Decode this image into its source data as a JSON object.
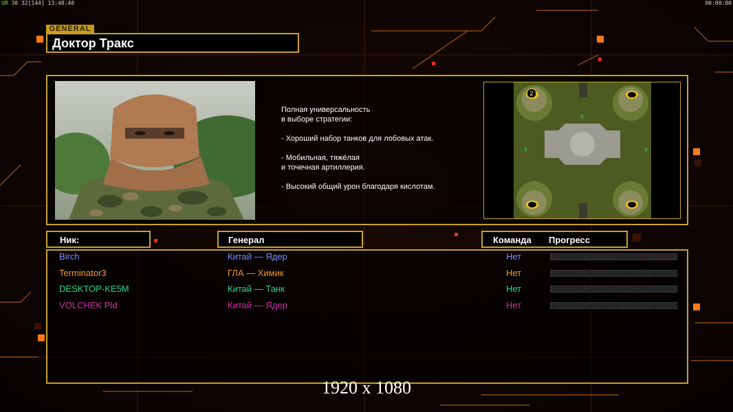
{
  "hud": {
    "stats_prefix": "UR",
    "fps": "30",
    "stat2": "32",
    "stat3": "[144]",
    "clock": "13:48:40",
    "timer": "00:00:00"
  },
  "general": {
    "tag": "GENERAL",
    "name": "Доктор Тракс"
  },
  "description": [
    "Полная универсальность",
    "в выборе стратегии:",
    "",
    "- Хороший набор танков для лобовых атак.",
    "",
    "- Мобильная, тяжёлая",
    "и точечная артиллерия.",
    "",
    "- Высокий общий урон благодаря кислотам."
  ],
  "map": {
    "start_marker": "2",
    "icon": "map-preview"
  },
  "headers": {
    "nick": "Ник:",
    "general": "Генерал",
    "team": "Команда",
    "progress": "Прогресс"
  },
  "players": [
    {
      "nick": "Birch",
      "general": "Китай — Ядер",
      "team": "Нет",
      "progress": 0,
      "color": "#7b8cff"
    },
    {
      "nick": "Terminator3",
      "general": "ГЛА — Химик",
      "team": "Нет",
      "progress": 0,
      "color": "#f09a28"
    },
    {
      "nick": "DESKTOP-KE5M",
      "general": "Китай — Танк",
      "team": "Нет",
      "progress": 0,
      "color": "#25d98a"
    },
    {
      "nick": "VOLCHEK Pld",
      "general": "Китай — Ядер",
      "team": "Нет",
      "progress": 0,
      "color": "#d82ab0"
    }
  ],
  "resolution": "1920 x 1080",
  "colors": {
    "accent": "#c9a227",
    "background": "#0c0503"
  }
}
